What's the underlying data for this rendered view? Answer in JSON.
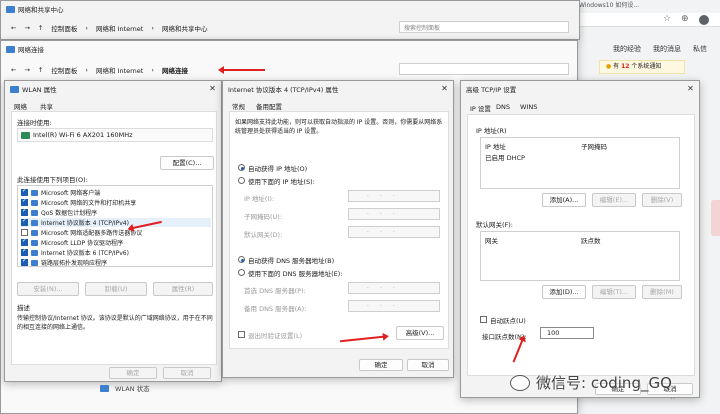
{
  "bg_window": {
    "title": "网络和共享中心",
    "breadcrumb": [
      "控制面板",
      "网络和 Internet",
      "网络和共享中心"
    ],
    "search_placeholder": "搜索控制面板"
  },
  "browser": {
    "tab_title": "Windows10 如何设...",
    "links": [
      "我的经验",
      "我的消息",
      "私信"
    ],
    "notice_prefix": "有",
    "notice_count": "12",
    "notice_suffix": "个系统通知"
  },
  "net_conn_window": {
    "title": "网络连接",
    "breadcrumb": [
      "控制面板",
      "网络和 Internet",
      "网络连接"
    ]
  },
  "wlan": {
    "title": "WLAN 属性",
    "tabs": [
      "网络",
      "共享"
    ],
    "connect_using_label": "连接时使用:",
    "adapter": "Intel(R) Wi-Fi 6 AX201 160MHz",
    "configure_btn": "配置(C)...",
    "items_label": "此连接使用下列项目(O):",
    "items": [
      {
        "label": "Microsoft 网络客户端",
        "checked": true
      },
      {
        "label": "Microsoft 网络的文件和打印机共享",
        "checked": true
      },
      {
        "label": "QoS 数据包计划程序",
        "checked": true
      },
      {
        "label": "Internet 协议版本 4 (TCP/IPv4)",
        "checked": true
      },
      {
        "label": "Microsoft 网络适配器多路传送器协议",
        "checked": false
      },
      {
        "label": "Microsoft LLDP 协议驱动程序",
        "checked": true
      },
      {
        "label": "Internet 协议版本 6 (TCP/IPv6)",
        "checked": true
      },
      {
        "label": "链路层拓扑发现响应程序",
        "checked": true
      }
    ],
    "install_btn": "安装(N)...",
    "uninstall_btn": "卸载(U)",
    "properties_btn": "属性(R)",
    "desc_label": "描述",
    "desc_text": "传输控制协议/Internet 协议。该协议是默认的广域网络协议，用于在不同的相互连接的网络上通信。",
    "ok_btn": "确定",
    "cancel_btn": "取消",
    "taskbar_status": "WLAN 状态"
  },
  "ipv4": {
    "title": "Internet 协议版本 4 (TCP/IPv4) 属性",
    "tabs": [
      "常规",
      "备用配置"
    ],
    "intro": "如果网络支持此功能，则可以获取自动指派的 IP 设置。否则，你需要从网络系统管理员处获得适当的 IP 设置。",
    "auto_ip": "自动获得 IP 地址(O)",
    "manual_ip": "使用下面的 IP 地址(S):",
    "ip_label": "IP 地址(I):",
    "mask_label": "子网掩码(U):",
    "gateway_label": "默认网关(D):",
    "auto_dns": "自动获得 DNS 服务器地址(B)",
    "manual_dns": "使用下面的 DNS 服务器地址(E):",
    "dns1_label": "首选 DNS 服务器(P):",
    "dns2_label": "备用 DNS 服务器(A):",
    "validate_label": "退出时验证设置(L)",
    "advanced_btn": "高级(V)...",
    "ok_btn": "确定",
    "cancel_btn": "取消"
  },
  "adv": {
    "title": "高级 TCP/IP 设置",
    "tabs": [
      "IP 设置",
      "DNS",
      "WINS"
    ],
    "ip_section": "IP 地址(R)",
    "ip_cols": [
      "IP 地址",
      "子网掩码"
    ],
    "ip_row": "已启用 DHCP",
    "add_btn": "添加(A)...",
    "edit_btn": "编辑(E)...",
    "delete_btn": "删除(V)",
    "gw_section": "默认网关(F):",
    "gw_cols": [
      "网关",
      "跃点数"
    ],
    "add_btn2": "添加(D)...",
    "edit_btn2": "编辑(T)...",
    "delete_btn2": "删除(M)",
    "auto_metric": "自动跃点(U)",
    "metric_label": "接口跃点数(N):",
    "metric_value": "100",
    "ok_btn": "确定",
    "cancel_btn": "取消"
  },
  "watermark": "微信号: coding_GQ",
  "colors": {
    "accent": "#1a5fb4",
    "arrow": "#e02020"
  }
}
